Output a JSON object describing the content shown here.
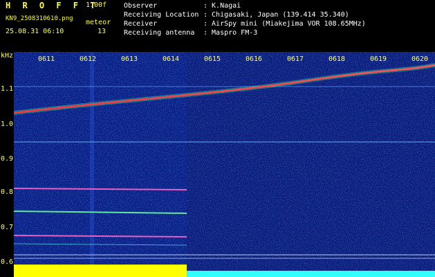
{
  "header": {
    "brand": "H R O F F T",
    "version": "1.00f",
    "filename": "KN9_2508310610.png",
    "datetime": "25.08.31 06:10",
    "meteor_label": "meteor",
    "meteor_count": "13",
    "info": [
      {
        "key": "Observer",
        "value": ": K.Nagai"
      },
      {
        "key": "Receiving Location",
        "value": ": Chigasaki, Japan (139.414 35.340)"
      },
      {
        "key": "Receiver",
        "value": ": AirSpy mini (Miakejima VOR 108.65MHz)"
      },
      {
        "key": "Receiving antenna",
        "value": ": Maspro FM-3"
      }
    ]
  },
  "axis": {
    "unit": "kHz",
    "y_labels": [
      "1.1",
      "1.0",
      "0.9",
      "0.8",
      "0.7",
      "0.6"
    ],
    "x_labels": [
      "0611",
      "0612",
      "0613",
      "0614",
      "0615",
      "0616",
      "0617",
      "0618",
      "0619",
      "0620"
    ]
  },
  "colors": {
    "background": "#0a1f86",
    "trace": "#ff3333",
    "label": "#ffff66",
    "lower_bar_left": "#ffff00",
    "lower_bar_right": "#33ffff"
  }
}
